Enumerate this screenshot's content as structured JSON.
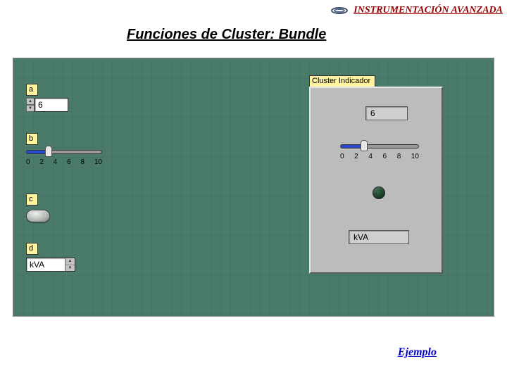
{
  "header": {
    "brand_text": "INSTRUMENTACIÓN AVANZADA"
  },
  "title": "Funciones de Cluster: Bundle",
  "controls": {
    "a": {
      "label": "a",
      "value": "6"
    },
    "b": {
      "label": "b",
      "ticks": [
        "0",
        "2",
        "4",
        "6",
        "8",
        "10"
      ],
      "fill_percent": 30
    },
    "c": {
      "label": "c"
    },
    "d": {
      "label": "d",
      "value": "kVA"
    }
  },
  "cluster": {
    "label": "Cluster Indicador",
    "numeric": "6",
    "slider": {
      "ticks": [
        "0",
        "2",
        "4",
        "6",
        "8",
        "10"
      ],
      "fill_percent": 30
    },
    "combo": "kVA"
  },
  "link": "Ejemplo"
}
